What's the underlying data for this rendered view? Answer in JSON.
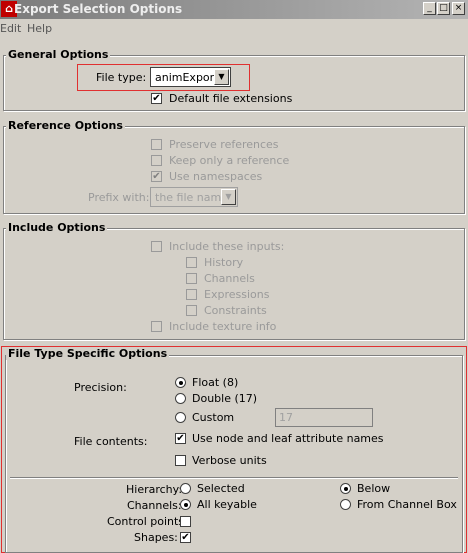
{
  "window": {
    "title": "Export Selection Options"
  },
  "menu": {
    "edit": "Edit",
    "help": "Help"
  },
  "general": {
    "title": "General Options",
    "file_type_label": "File type:",
    "file_type_value": "animExport",
    "default_ext_label": "Default file extensions",
    "default_ext_checked": true
  },
  "reference": {
    "title": "Reference Options",
    "preserve_label": "Preserve references",
    "keep_label": "Keep only a reference",
    "namespaces_label": "Use namespaces",
    "prefix_label": "Prefix with:",
    "prefix_value": "the file name"
  },
  "include": {
    "title": "Include Options",
    "inputs_label": "Include these inputs:",
    "history_label": "History",
    "channels_label": "Channels",
    "expressions_label": "Expressions",
    "constraints_label": "Constraints",
    "texture_label": "Include texture info"
  },
  "specific": {
    "title": "File Type Specific Options",
    "precision_label": "Precision:",
    "float_label": "Float (8)",
    "double_label": "Double (17)",
    "custom_label": "Custom",
    "custom_value": "17",
    "contents_label": "File contents:",
    "node_leaf_label": "Use node and leaf attribute names",
    "verbose_label": "Verbose units",
    "hierarchy_label": "Hierarchy:",
    "selected_label": "Selected",
    "below_label": "Below",
    "channels_label": "Channels:",
    "all_keyable_label": "All keyable",
    "from_channel_box_label": "From Channel Box",
    "control_points_label": "Control points:",
    "shapes_label": "Shapes:"
  },
  "colors": {
    "highlight": "#e03030",
    "titlebar": "#7b7b7b"
  }
}
